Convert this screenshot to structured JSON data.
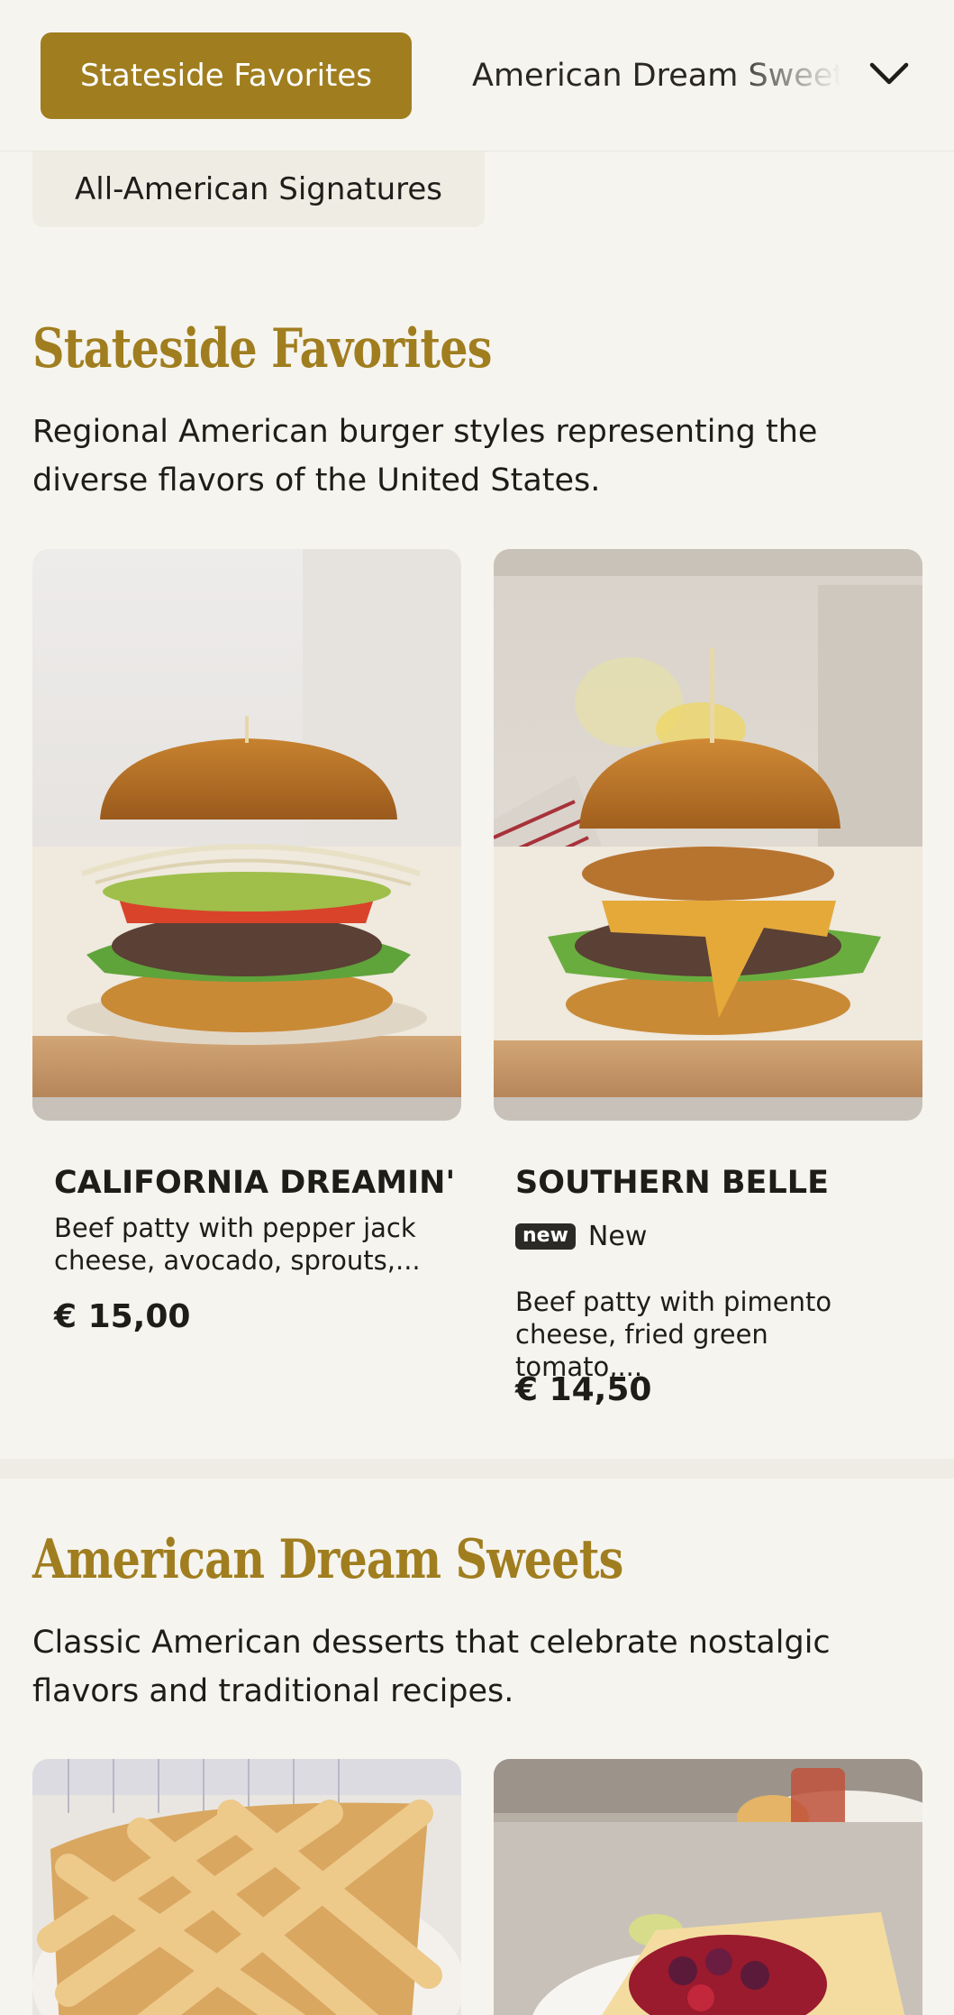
{
  "nav": {
    "active_category": "Stateside Favorites",
    "next_category": "American Dream Sweets",
    "secondary_category": "All-American Signatures",
    "dropdown_icon": "chevron-down-icon"
  },
  "colors": {
    "accent": "#a07e1f",
    "background": "#f6f4ef",
    "badge": "#2b2a27"
  },
  "sections": [
    {
      "title": "Stateside Favorites",
      "description": "Regional American burger styles representing the diverse flavors of the United States.",
      "items": [
        {
          "name": "CALIFORNIA DREAMIN'",
          "description_line1": "Beef patty with pepper jack",
          "description_line2": "cheese, avocado, sprouts,...",
          "price": "€ 15,00"
        },
        {
          "name": "SOUTHERN BELLE",
          "badge": "new",
          "badge_text": "New",
          "description_line1": "Beef patty with pimento",
          "description_line2": "cheese, fried green tomato,...",
          "price": "€ 14,50"
        }
      ]
    },
    {
      "title": "American Dream Sweets",
      "description": "Classic American desserts that celebrate nostalgic flavors and traditional recipes."
    }
  ]
}
